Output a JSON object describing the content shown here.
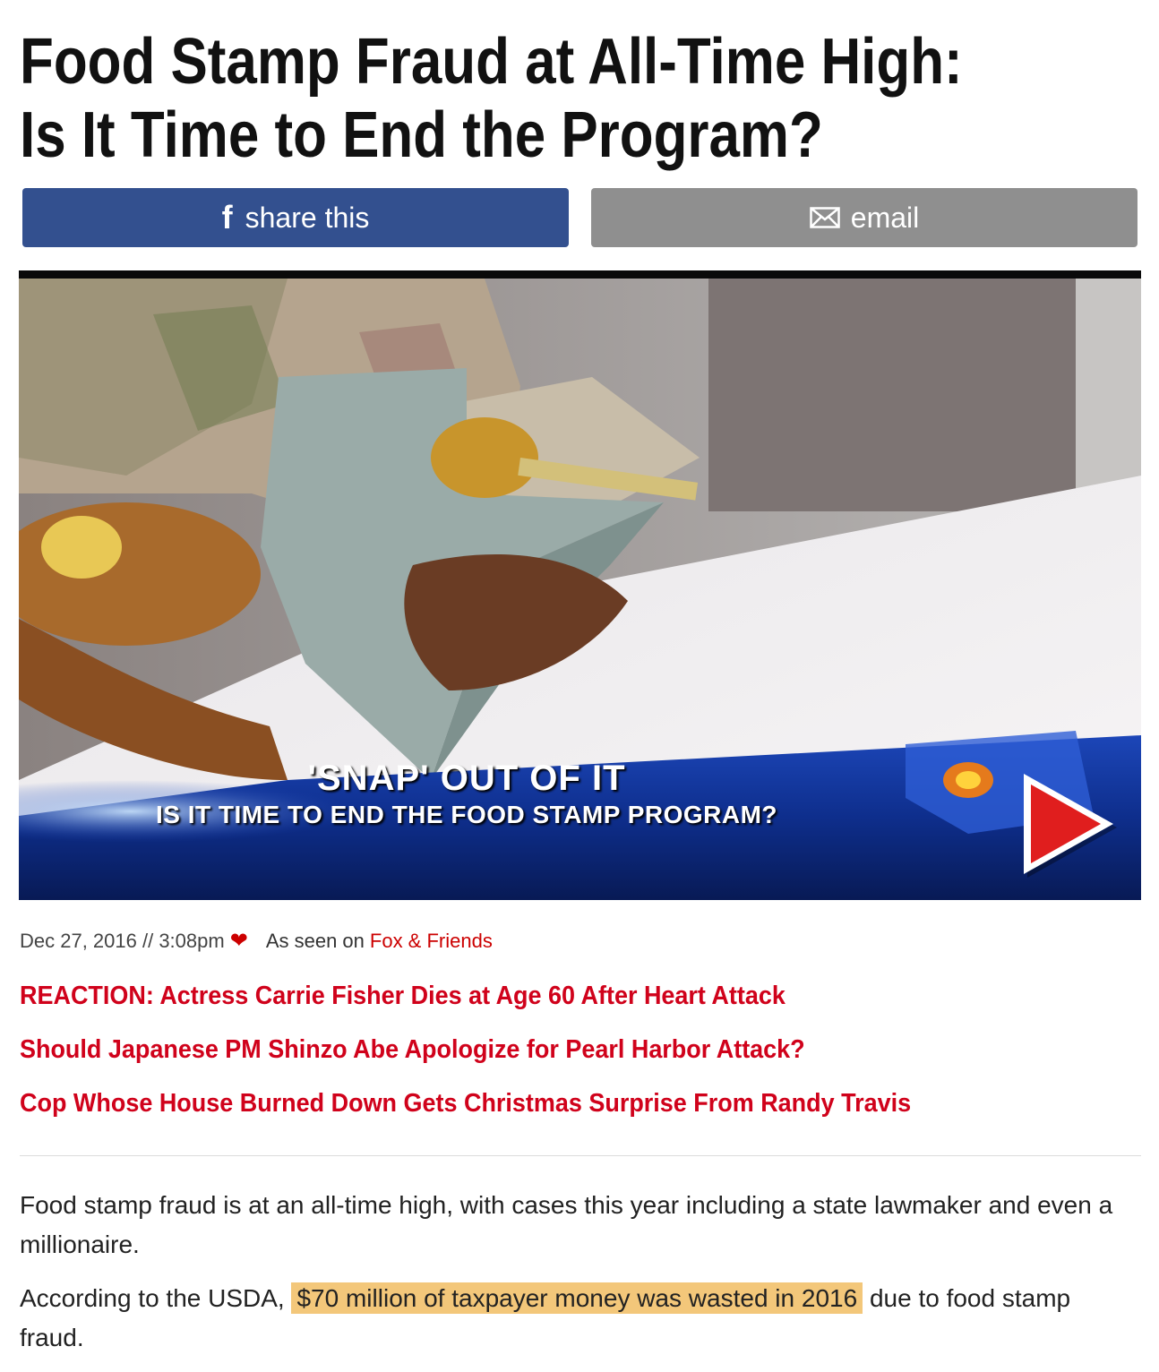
{
  "article": {
    "headline_line1": "Food Stamp Fraud at All-Time High:",
    "headline_line2": "Is It Time to End the Program?"
  },
  "share": {
    "facebook_label": "share this",
    "facebook_icon": "facebook-icon",
    "email_label": "email",
    "email_icon": "envelope-icon"
  },
  "video": {
    "chyron_title": "'SNAP' OUT OF IT",
    "chyron_subtitle": "IS IT TIME TO END THE FOOD STAMP PROGRAM?",
    "play_icon": "play-icon"
  },
  "meta": {
    "date": "Dec 27, 2016 // 3:08pm",
    "seen_on_label": "As seen on",
    "show_name": "Fox & Friends"
  },
  "related_links": [
    "REACTION: Actress Carrie Fisher Dies at Age 60 After Heart Attack",
    "Should Japanese PM Shinzo Abe Apologize for Pearl Harbor Attack?",
    "Cop Whose House Burned Down Gets Christmas Surprise From Randy Travis"
  ],
  "body": {
    "paragraph1": "Food stamp fraud is at an all-time high, with cases this year including a state lawmaker and even a millionaire.",
    "paragraph2_prefix": "According to the USDA, ",
    "paragraph2_highlight": "$70 million of taxpayer money was wasted in 2016",
    "paragraph2_suffix": " due to food stamp fraud."
  },
  "colors": {
    "facebook_blue": "#33508f",
    "email_gray": "#8f8f8f",
    "link_red": "#d0021b",
    "highlight": "#f3c77a"
  }
}
